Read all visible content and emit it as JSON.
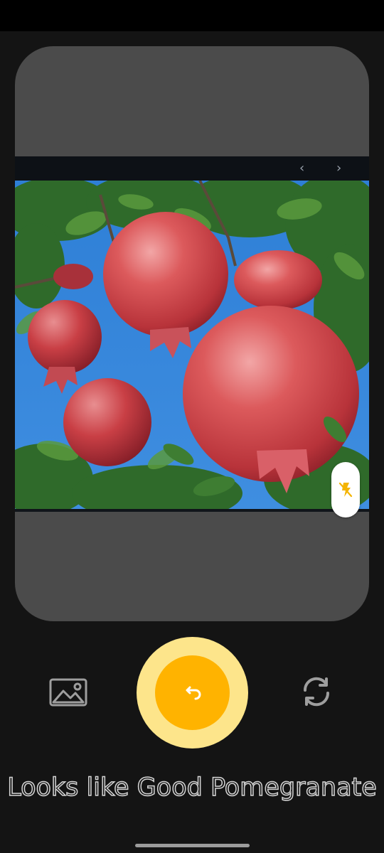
{
  "viewfinder": {
    "prev_arrow": "‹",
    "next_arrow": "›",
    "photo_subject": "pomegranates on tree"
  },
  "controls": {
    "flash_icon": "flash-off-icon",
    "gallery_icon": "gallery-image-icon",
    "shutter_icon": "undo-icon",
    "switch_icon": "switch-camera-icon"
  },
  "result": {
    "text": "Looks like Good Pomegranate"
  },
  "colors": {
    "accent": "#ffb300",
    "accent_light": "#fde58b",
    "background": "#141414",
    "viewfinder": "#4b4b4b"
  }
}
